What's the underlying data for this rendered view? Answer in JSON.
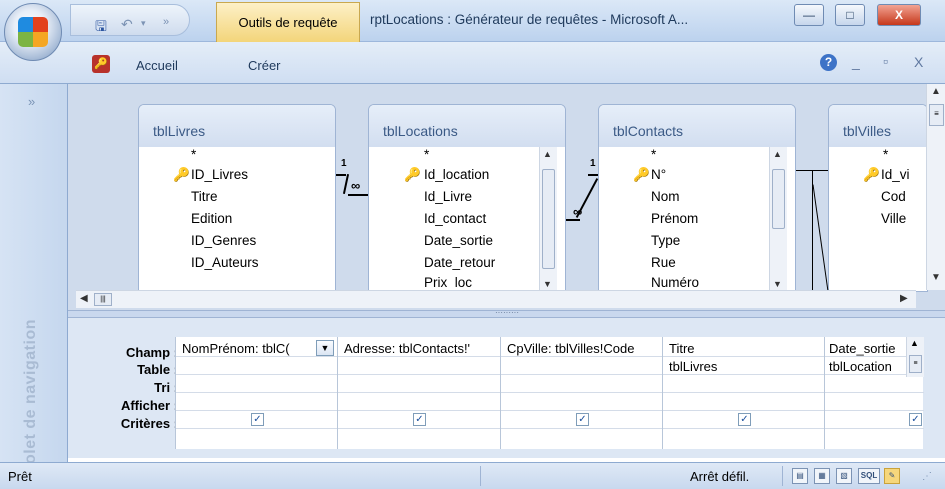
{
  "window": {
    "context_tab": "Outils de requête",
    "title": "rptLocations : Générateur de requêtes - Microsoft A...",
    "min_label": "—",
    "max_label": "□",
    "close_label": "X"
  },
  "ribbon": {
    "tabs": [
      "Accueil",
      "Créer"
    ],
    "help": "?",
    "right_controls": [
      "_",
      "▫",
      "X"
    ]
  },
  "nav": {
    "toggle": "»",
    "label": "Volet de navigation"
  },
  "tables": [
    {
      "title": "tblLivres",
      "fields": [
        "*",
        "ID_Livres",
        "Titre",
        "Edition",
        "ID_Genres",
        "ID_Auteurs"
      ],
      "key_index": 1
    },
    {
      "title": "tblLocations",
      "fields": [
        "*",
        "Id_location",
        "Id_Livre",
        "Id_contact",
        "Date_sortie",
        "Date_retour",
        "Prix_loc"
      ],
      "key_index": 1
    },
    {
      "title": "tblContacts",
      "fields": [
        "*",
        "N°",
        "Nom",
        "Prénom",
        "Type",
        "Rue",
        "Numéro"
      ],
      "key_index": 1
    },
    {
      "title": "tblVilles",
      "fields": [
        "*",
        "Id_vi",
        "Cod",
        "Ville"
      ],
      "key_index": 1
    }
  ],
  "relations": [
    {
      "one": "1",
      "many": "∞"
    },
    {
      "one": "1",
      "many": "∞"
    }
  ],
  "grid": {
    "row_labels": [
      "Champ :",
      "Table :",
      "Tri :",
      "Afficher :",
      "Critères :"
    ],
    "columns": [
      {
        "champ": "NomPrénom: tblC(",
        "table": "",
        "show": true
      },
      {
        "champ": "Adresse: tblContacts!'",
        "table": "",
        "show": true
      },
      {
        "champ": "CpVille: tblVilles!Code",
        "table": "",
        "show": true
      },
      {
        "champ": "Titre",
        "table": "tblLivres",
        "show": true
      },
      {
        "champ": "Date_sortie",
        "table": "tblLocation",
        "show": true
      }
    ]
  },
  "status": {
    "left": "Prêt",
    "right": "Arrêt défil.",
    "views": [
      "▤",
      "▦",
      "▧",
      "SQL",
      "✎"
    ]
  }
}
